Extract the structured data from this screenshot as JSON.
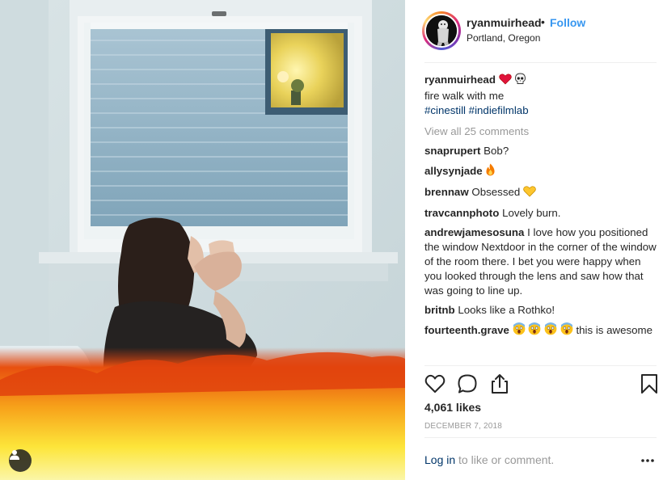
{
  "post": {
    "username": "ryanmuirhead",
    "follow_sep": "•",
    "follow_label": "Follow",
    "location": "Portland, Oregon"
  },
  "caption": {
    "username": "ryanmuirhead",
    "text": "fire walk with me",
    "hashtags": "#cinestill #indiefilmlab",
    "emojis": [
      "heart-icon",
      "skull-icon"
    ]
  },
  "view_all_comments": "View all 25 comments",
  "comments": [
    {
      "user": "snaprupert",
      "text": "Bob?"
    },
    {
      "user": "allysynjade",
      "text": "",
      "emoji": "fire-icon"
    },
    {
      "user": "brennaw",
      "text": "Obsessed",
      "emoji": "yellow-heart-icon"
    },
    {
      "user": "travcannphoto",
      "text": "Lovely burn."
    },
    {
      "user": "andrewjamesosuna",
      "text": "I love how you positioned the window Nextdoor in the corner of the window of the room there. I bet you were happy when you looked through the lens and saw how that was going to line up."
    },
    {
      "user": "britnb",
      "text": "Looks like a Rothko!"
    },
    {
      "user": "fourteenth.grave",
      "text": "this is awesome",
      "emoji": "screaming-face-icon x4"
    }
  ],
  "likes": "4,061 likes",
  "date": "DECEMBER 7, 2018",
  "footer": {
    "login_label": "Log in",
    "rest": "to like or comment."
  },
  "colors": {
    "link_blue": "#3897f0",
    "hashtag_navy": "#003569",
    "muted_gray": "#999999",
    "text_dark": "#262626"
  }
}
